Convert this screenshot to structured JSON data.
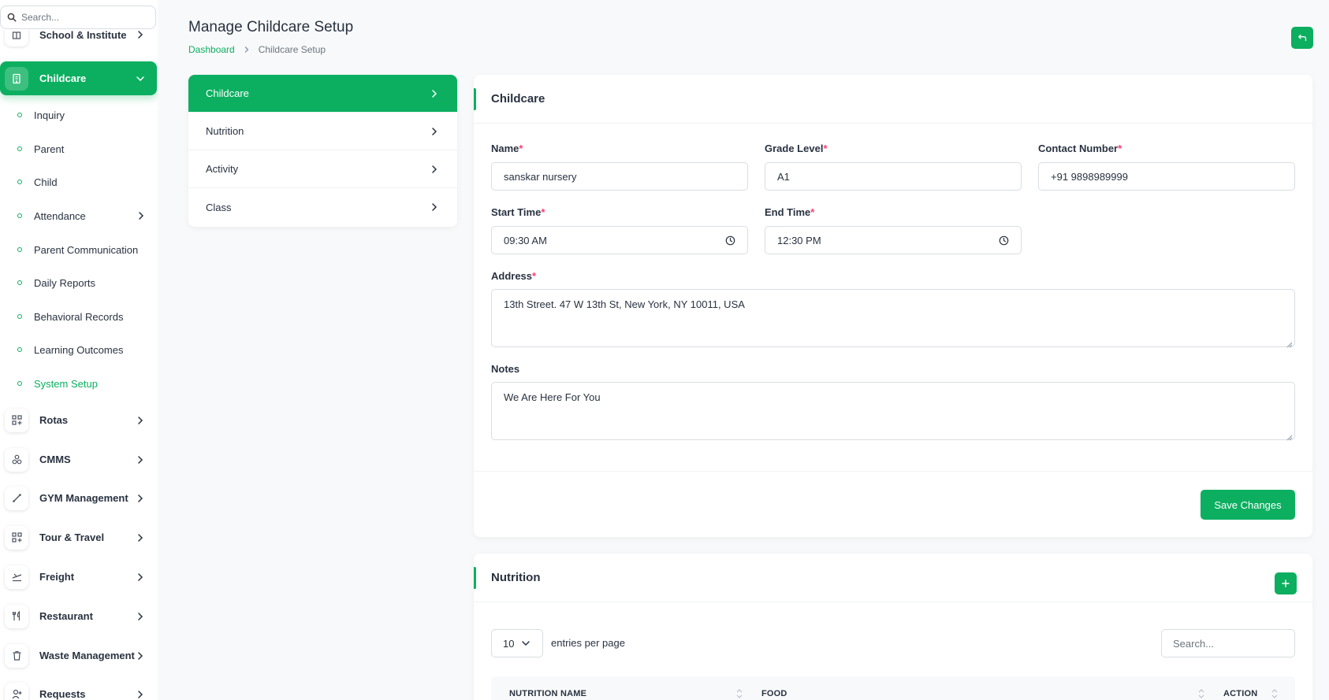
{
  "sidebar": {
    "search_placeholder": "Search...",
    "top_item_label": "School & Institute",
    "active_group": {
      "label": "Childcare"
    },
    "sub_items": [
      {
        "label": "Inquiry"
      },
      {
        "label": "Parent"
      },
      {
        "label": "Child"
      },
      {
        "label": "Attendance"
      },
      {
        "label": "Parent Communication"
      },
      {
        "label": "Daily Reports"
      },
      {
        "label": "Behavioral Records"
      },
      {
        "label": "Learning Outcomes"
      },
      {
        "label": "System Setup"
      }
    ],
    "groups": [
      {
        "label": "Rotas"
      },
      {
        "label": "CMMS"
      },
      {
        "label": "GYM Management"
      },
      {
        "label": "Tour & Travel"
      },
      {
        "label": "Freight"
      },
      {
        "label": "Restaurant"
      },
      {
        "label": "Waste Management"
      },
      {
        "label": "Requests"
      }
    ]
  },
  "header": {
    "title": "Manage Childcare Setup",
    "breadcrumb": {
      "home": "Dashboard",
      "current": "Childcare Setup"
    }
  },
  "setup_tabs": [
    {
      "label": "Childcare"
    },
    {
      "label": "Nutrition"
    },
    {
      "label": "Activity"
    },
    {
      "label": "Class"
    }
  ],
  "form": {
    "title": "Childcare",
    "required_mark": "*",
    "name": {
      "label": "Name",
      "value": "sanskar nursery"
    },
    "grade": {
      "label": "Grade Level",
      "value": "A1"
    },
    "contact": {
      "label": "Contact Number",
      "value": "+91 9898989999"
    },
    "start_time": {
      "label": "Start Time",
      "value": "09:30 AM"
    },
    "end_time": {
      "label": "End Time",
      "value": "12:30 PM"
    },
    "address": {
      "label": "Address",
      "value": "13th Street. 47 W 13th St, New York, NY 10011, USA"
    },
    "notes": {
      "label": "Notes",
      "value": "We Are Here For You"
    },
    "save_label": "Save Changes"
  },
  "nutrition": {
    "title": "Nutrition",
    "entries_value": "10",
    "entries_label": "entries per page",
    "search_placeholder": "Search...",
    "columns": [
      "NUTRITION NAME",
      "FOOD",
      "ACTION"
    ]
  },
  "colors": {
    "accent": "#0caf60",
    "required": "#ff3a6e"
  }
}
